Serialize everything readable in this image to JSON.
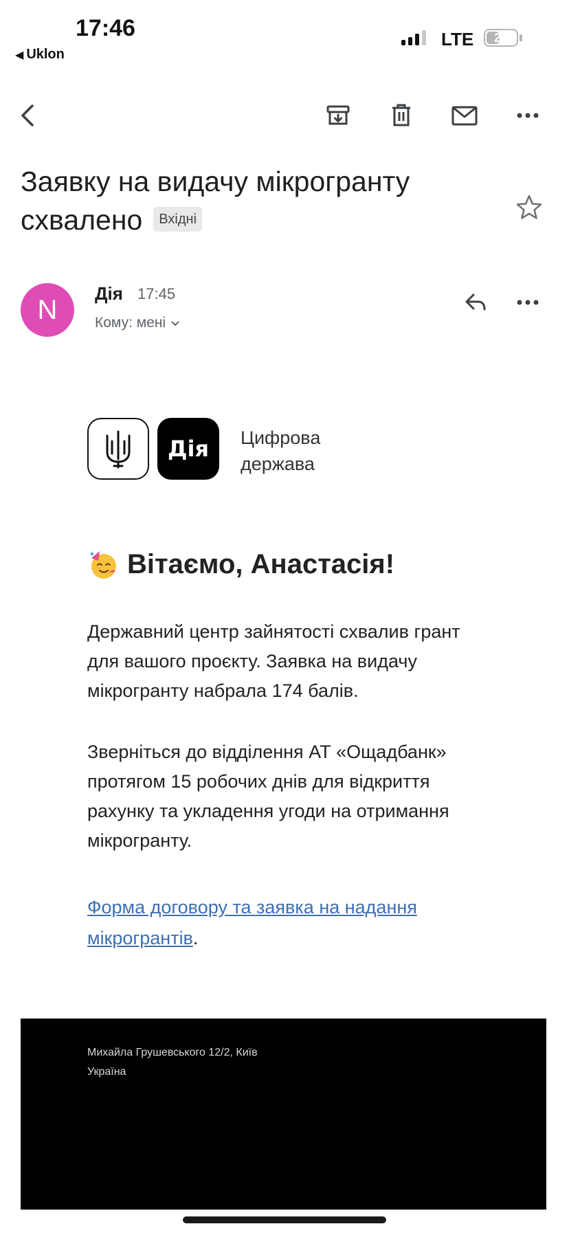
{
  "status_bar": {
    "time": "17:46",
    "back_app": "Uklon",
    "network": "LTE",
    "battery": "21",
    "battery_level_percent": 21
  },
  "email": {
    "subject": "Заявку на видачу мікрогранту схвалено",
    "label": "Вхідні",
    "sender": {
      "avatar_letter": "N",
      "avatar_color": "#e04cb6",
      "name": "Дія",
      "time": "17:45",
      "recipient": "Кому: мені"
    }
  },
  "body": {
    "logo_text": "Дія",
    "tagline_line1": "Цифрова",
    "tagline_line2": "держава",
    "greeting": "Вітаємо, Анастасія!",
    "paragraph1": "Державний центр зайнятості схвалив грант для вашого проєкту. Заявка на видачу мікрогранту набрала 174 балів.",
    "paragraph2": "Зверніться до відділення АТ «Ощадбанк» протягом 15 робочих днів для відкриття рахунку та укладення угоди на отримання мікрогранту.",
    "link_text": "Форма договору та заявка на надання мікрогрантів",
    "link_suffix": ".",
    "link_color": "#3c6fb4"
  },
  "footer": {
    "address_line1": "Михайла Грушевського 12/2, Київ",
    "address_line2": "Україна"
  }
}
